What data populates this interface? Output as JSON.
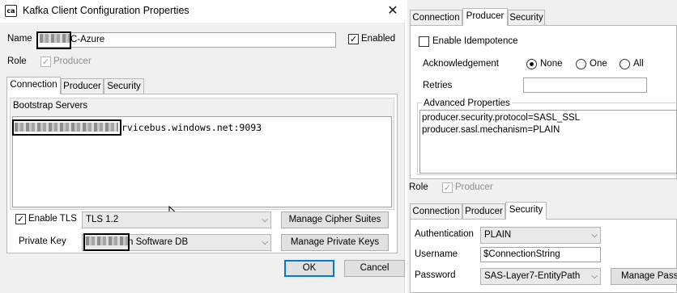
{
  "window": {
    "title": "Kafka Client Configuration Properties",
    "icon_text": "ca",
    "close_glyph": "✕"
  },
  "name_field": {
    "label": "Name",
    "value": "C-Azure",
    "enabled_label": "Enabled",
    "enabled_checked": true
  },
  "role": {
    "label": "Role",
    "option": "Producer",
    "checked": true
  },
  "tabs": [
    "Connection",
    "Producer",
    "Security"
  ],
  "connection": {
    "bootstrap_label": "Bootstrap Servers",
    "bootstrap_value": "rvicebus.windows.net:9093",
    "enable_tls_label": "Enable TLS",
    "enable_tls_checked": true,
    "tls_version": "TLS 1.2",
    "manage_cipher_label": "Manage Cipher Suites",
    "private_key_label": "Private Key",
    "private_key_value": "n Software DB",
    "manage_keys_label": "Manage Private Keys"
  },
  "footer": {
    "ok": "OK",
    "cancel": "Cancel"
  },
  "producer_panel": {
    "tabs": [
      "Connection",
      "Producer",
      "Security"
    ],
    "idempotence_label": "Enable Idempotence",
    "ack_label": "Acknowledgement",
    "ack_options": [
      "None",
      "One",
      "All"
    ],
    "ack_selected": "None",
    "retries_label": "Retries",
    "retries_value": "",
    "advanced_label": "Advanced Properties",
    "advanced_lines": [
      "producer.security.protocol=SASL_SSL",
      "producer.sasl.mechanism=PLAIN"
    ]
  },
  "security_panel": {
    "role_label": "Role",
    "role_option": "Producer",
    "tabs": [
      "Connection",
      "Producer",
      "Security"
    ],
    "auth_label": "Authentication",
    "auth_value": "PLAIN",
    "username_label": "Username",
    "username_value": "$ConnectionString",
    "password_label": "Password",
    "password_value": "SAS-Layer7-EntityPath",
    "manage_pass_label": "Manage Passw"
  }
}
